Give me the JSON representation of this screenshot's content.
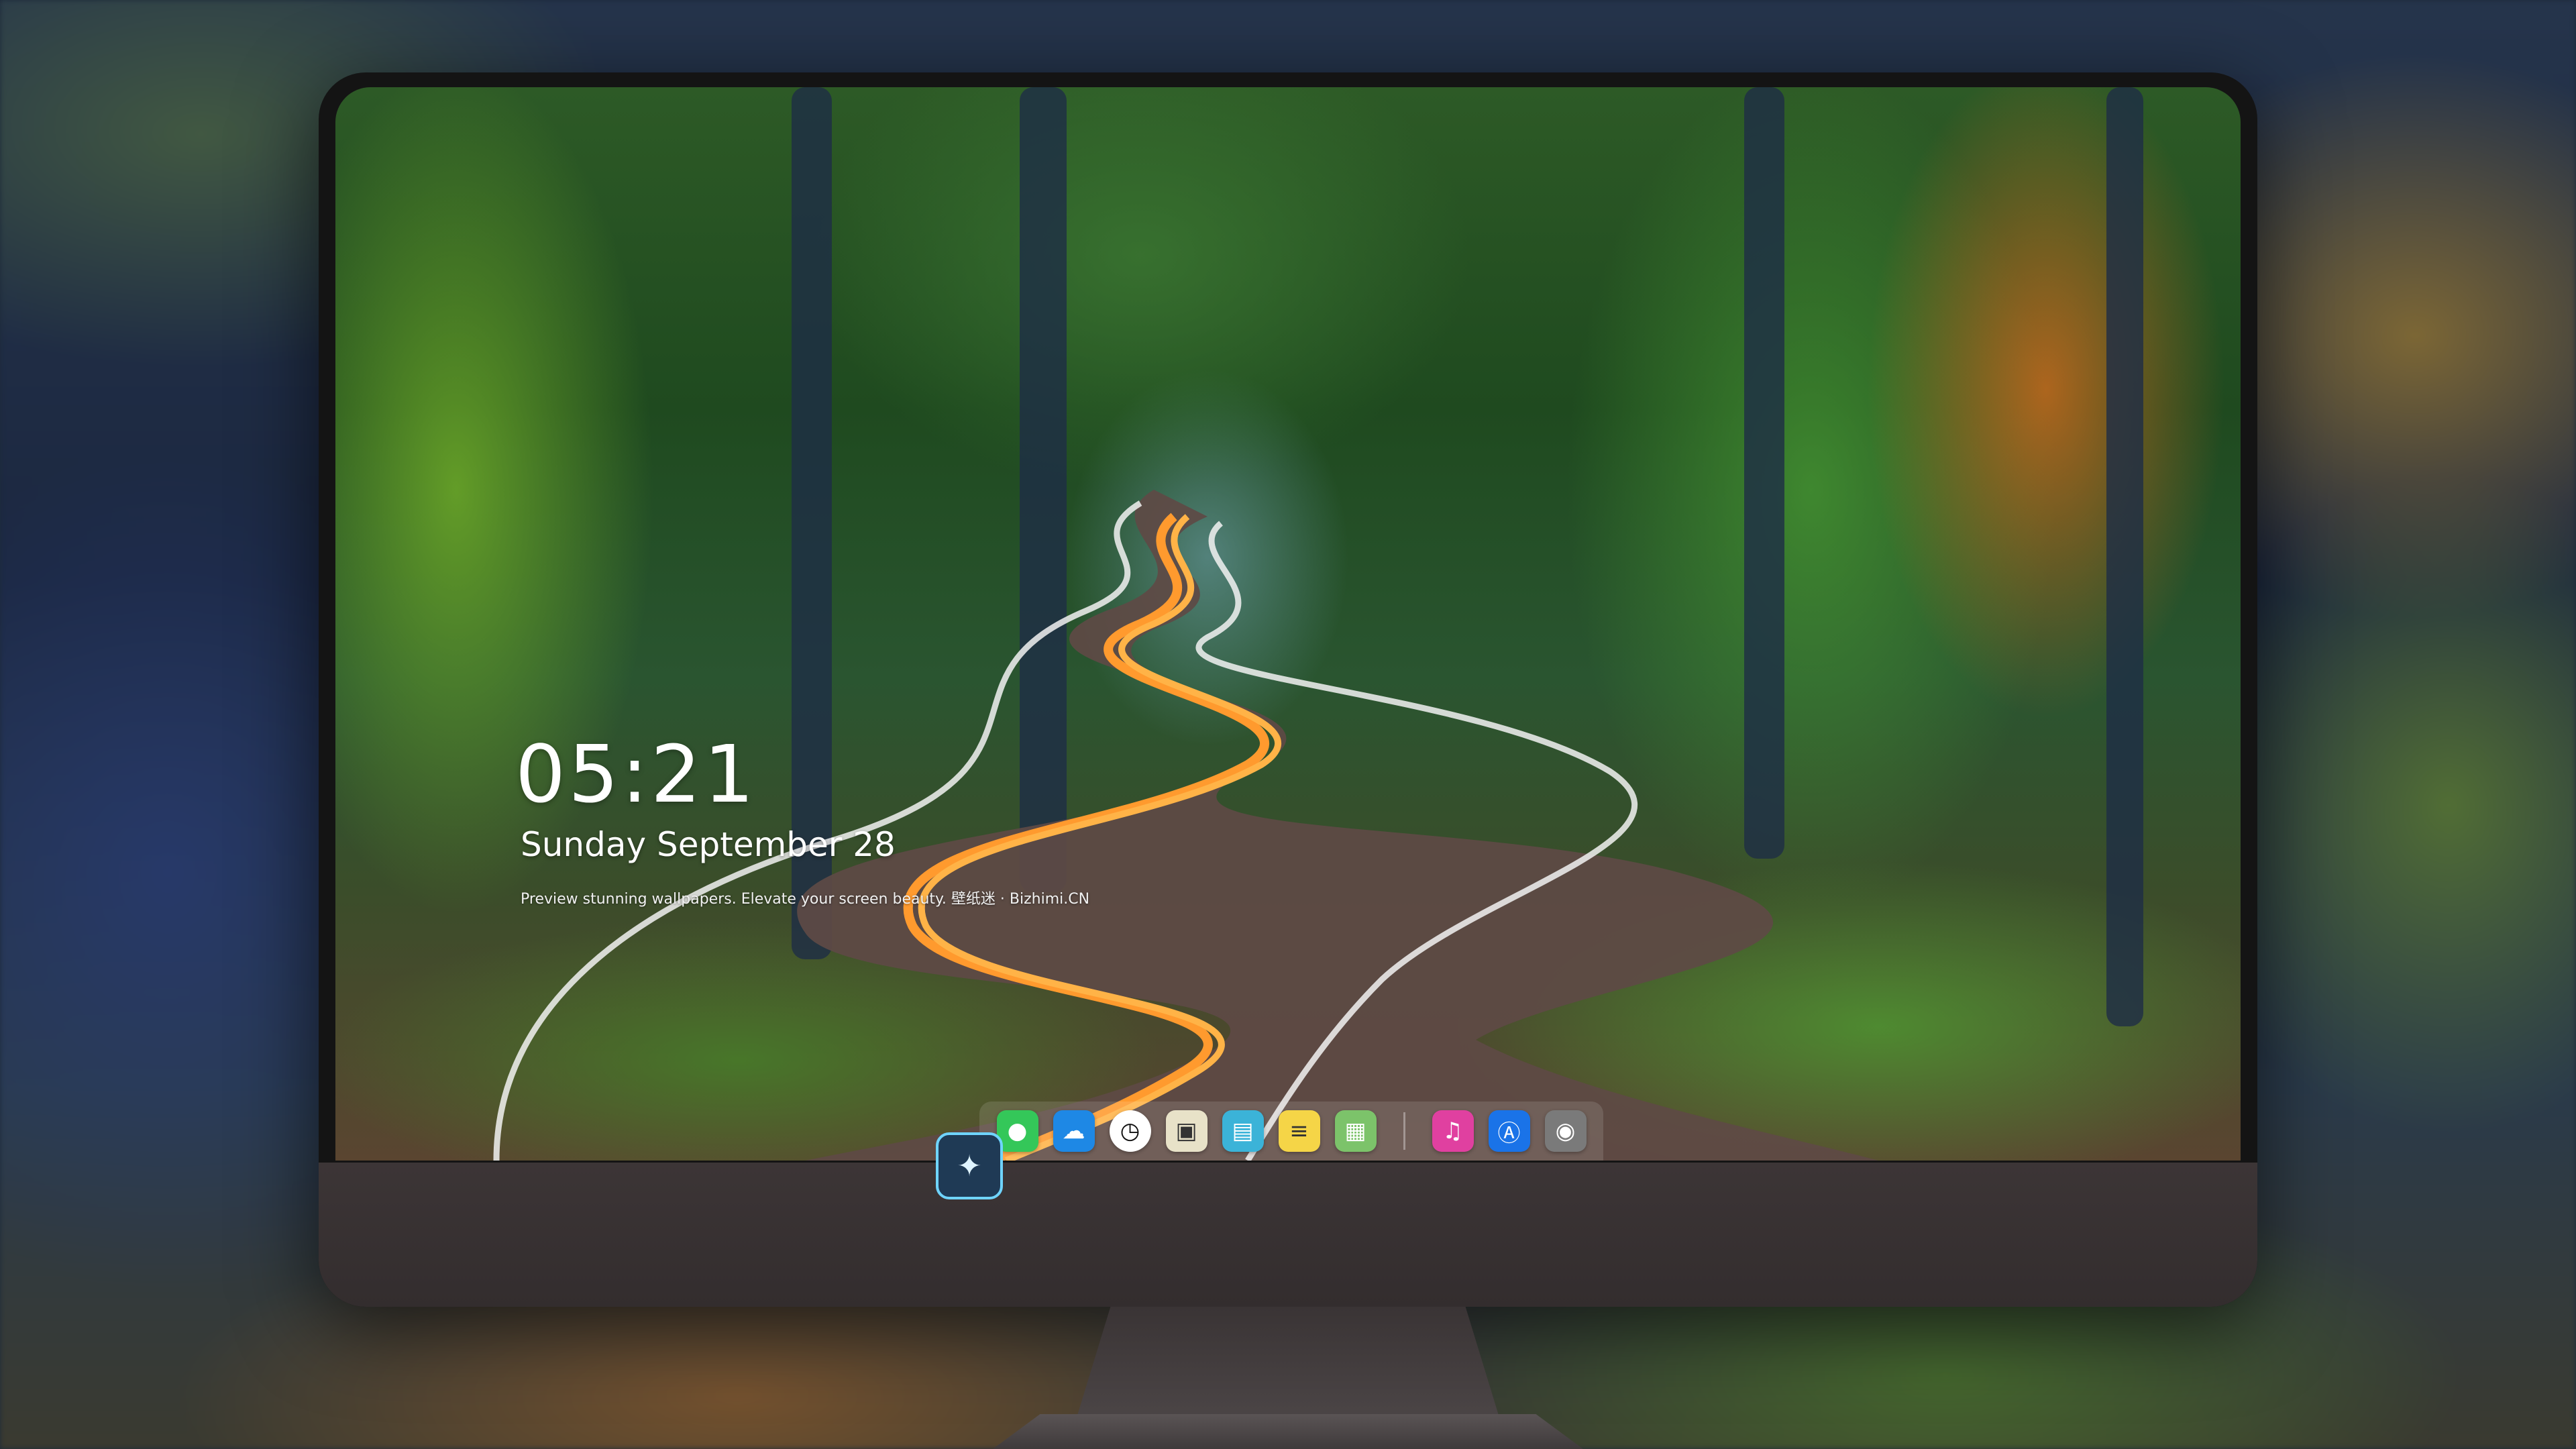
{
  "lockscreen": {
    "time": "05:21",
    "date": "Sunday September  28",
    "tagline": "Preview stunning wallpapers. Elevate your screen beauty. 壁纸迷 · Bizhimi.CN"
  },
  "dock": {
    "apps": [
      {
        "name": "messages",
        "icon": "speech-bubble-icon",
        "glyph": "●",
        "color": "#34c759"
      },
      {
        "name": "weather",
        "icon": "cloud-icon",
        "glyph": "☁",
        "color": "#1e88e5"
      },
      {
        "name": "clock",
        "icon": "clock-icon",
        "glyph": "◷",
        "color": "#111111"
      },
      {
        "name": "preview",
        "icon": "photo-viewer-icon",
        "glyph": "▣",
        "color": "#e8e2c8"
      },
      {
        "name": "video",
        "icon": "clapperboard-icon",
        "glyph": "▤",
        "color": "#3bb3d8"
      },
      {
        "name": "notes",
        "icon": "notes-icon",
        "glyph": "≡",
        "color": "#f5d547"
      },
      {
        "name": "gallery",
        "icon": "photos-grid-icon",
        "glyph": "▦",
        "color": "#7cc36a"
      }
    ],
    "pinned": [
      {
        "name": "music",
        "icon": "music-note-icon",
        "glyph": "♫",
        "color": "#e040a0"
      },
      {
        "name": "app-store",
        "icon": "app-store-icon",
        "glyph": "Ⓐ",
        "color": "#1a73e8"
      },
      {
        "name": "camera",
        "icon": "camera-icon",
        "glyph": "◉",
        "color": "#7a7a7a"
      }
    ]
  },
  "monitor": {
    "logo_icon": "fox-mascot-logo-icon",
    "logo_glyph": "✦"
  }
}
